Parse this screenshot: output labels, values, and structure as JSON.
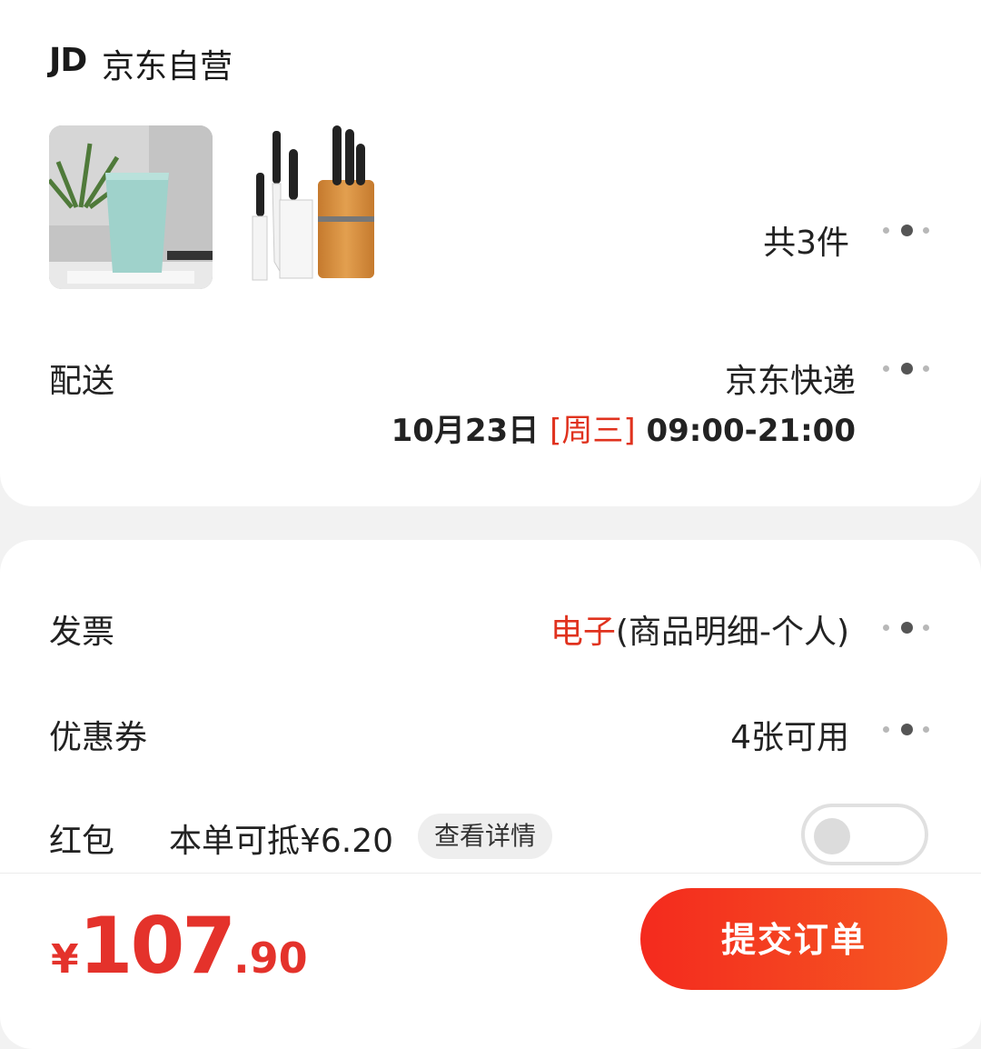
{
  "shop": {
    "logo": "JD",
    "name": "京东自营"
  },
  "products": {
    "items": [
      {
        "icon": "cup-image"
      },
      {
        "icon": "knife-set-image"
      }
    ],
    "count_label": "共3件"
  },
  "delivery": {
    "label": "配送",
    "method": "京东快递",
    "date": "10月23日",
    "weekday": "[周三]",
    "time": "09:00-21:00"
  },
  "invoice": {
    "label": "发票",
    "type": "电子",
    "detail": "(商品明细-个人)"
  },
  "coupon": {
    "label": "优惠券",
    "value": "4张可用"
  },
  "redpacket": {
    "label": "红包",
    "value": "本单可抵¥6.20",
    "detail_button": "查看详情",
    "enabled": false
  },
  "total": {
    "currency": "¥",
    "integer": "107",
    "decimal": ".90"
  },
  "submit_label": "提交订单",
  "colors": {
    "accent": "#e0321e",
    "price": "#e4322b",
    "button_start": "#f42a1e",
    "button_end": "#f55a22"
  }
}
